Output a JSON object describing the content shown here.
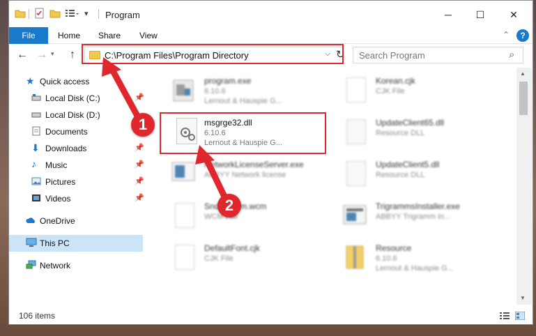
{
  "window": {
    "title": "Program"
  },
  "ribbon": {
    "tabs": [
      "File",
      "Home",
      "Share",
      "View"
    ],
    "help_label": "?"
  },
  "address_bar": {
    "path": "C:\\Program Files\\Program Directory"
  },
  "search": {
    "placeholder": "Search Program"
  },
  "sidebar": {
    "items": [
      {
        "label": "Quick access",
        "icon": "star-icon"
      },
      {
        "label": "Local Disk (C:)",
        "icon": "drive-icon",
        "pinned": true
      },
      {
        "label": "Local Disk (D:)",
        "icon": "drive-icon"
      },
      {
        "label": "Documents",
        "icon": "documents-icon"
      },
      {
        "label": "Downloads",
        "icon": "download-icon",
        "pinned": true
      },
      {
        "label": "Music",
        "icon": "music-icon",
        "pinned": true
      },
      {
        "label": "Pictures",
        "icon": "pictures-icon",
        "pinned": true
      },
      {
        "label": "Videos",
        "icon": "videos-icon",
        "pinned": true
      },
      {
        "label": "OneDrive",
        "icon": "cloud-icon"
      },
      {
        "label": "This PC",
        "icon": "computer-icon",
        "selected": true
      },
      {
        "label": "Network",
        "icon": "network-icon"
      }
    ]
  },
  "files": [
    {
      "name": "program.exe",
      "line2": "6.10.6",
      "line3": "Lernout & Hauspie G..."
    },
    {
      "name": "Korean.cjk",
      "line2": "CJK File",
      "line3": ""
    },
    {
      "name": "msgrge32.dll",
      "line2": "6.10.6",
      "line3": "Lernout & Hauspie G..."
    },
    {
      "name": "UpdateClient65.dll",
      "line2": "Resource DLL",
      "line3": ""
    },
    {
      "name": "NetworkLicenseServer.exe",
      "line2": "ABBYY Network license",
      "line3": ""
    },
    {
      "name": "UpdateClient5.dll",
      "line2": "Resource DLL",
      "line3": ""
    },
    {
      "name": "SndToWcm.wcm",
      "line2": "WCM File",
      "line3": ""
    },
    {
      "name": "TrigrammsInstaller.exe",
      "line2": "ABBYY Trigramm In...",
      "line3": ""
    },
    {
      "name": "DefaultFont.cjk",
      "line2": "CJK File",
      "line3": ""
    },
    {
      "name": "Resource",
      "line2": "6.10.6",
      "line3": "Lernout & Hauspie G..."
    }
  ],
  "status": {
    "item_count": "106 items"
  },
  "annotations": {
    "step1": "1",
    "step2": "2"
  },
  "colors": {
    "accent": "#1979ca",
    "highlight": "#e0272e",
    "selection": "#cce4f7"
  }
}
